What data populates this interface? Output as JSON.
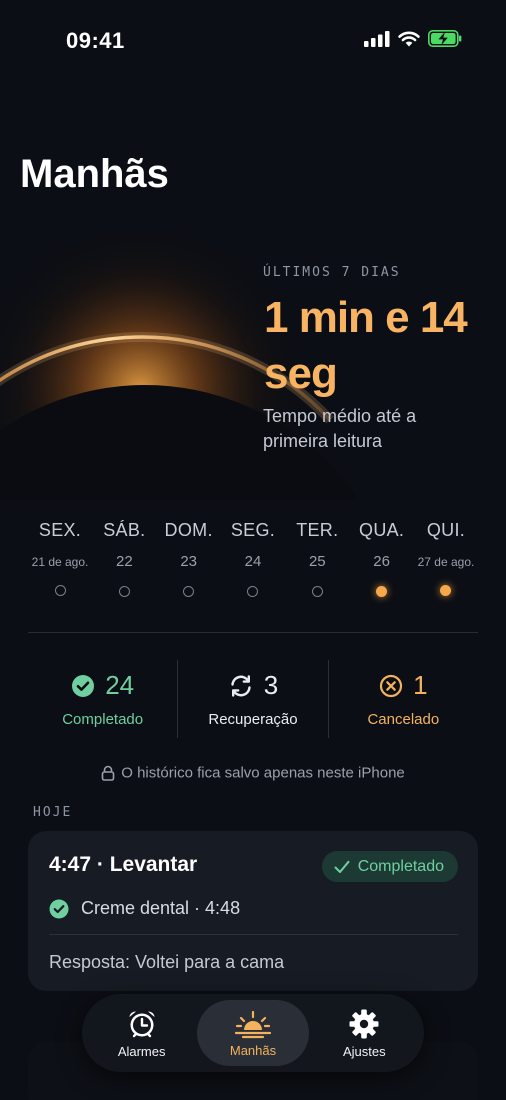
{
  "status_bar": {
    "time": "09:41"
  },
  "page": {
    "title": "Manhãs"
  },
  "hero": {
    "label": "ÚLTIMOS 7 DIAS",
    "value": "1 min e 14 seg",
    "subtitle": "Tempo médio até a primeira leitura"
  },
  "days": [
    {
      "name": "SEX.",
      "date": "21 de ago.",
      "filled": false
    },
    {
      "name": "SÁB.",
      "date": "22",
      "filled": false
    },
    {
      "name": "DOM.",
      "date": "23",
      "filled": false
    },
    {
      "name": "SEG.",
      "date": "24",
      "filled": false
    },
    {
      "name": "TER.",
      "date": "25",
      "filled": false
    },
    {
      "name": "QUA.",
      "date": "26",
      "filled": true
    },
    {
      "name": "QUI.",
      "date": "27 de ago.",
      "filled": true
    }
  ],
  "stats": {
    "completed": {
      "count": "24",
      "label": "Completado",
      "color": "#6fcf9f"
    },
    "recovery": {
      "count": "3",
      "label": "Recuperação",
      "color": "#e9ecf1"
    },
    "cancelled": {
      "count": "1",
      "label": "Cancelado",
      "color": "#f4b25e"
    }
  },
  "privacy_note": "O histórico fica salvo apenas neste iPhone",
  "today": {
    "section_label": "HOJE",
    "card": {
      "title": "4:47 · Levantar",
      "badge": "Completado",
      "task": "Creme dental · 4:48",
      "answer": "Resposta: Voltei para a cama"
    }
  },
  "tabs": [
    {
      "label": "Alarmes",
      "icon": "alarm-clock-icon",
      "active": false
    },
    {
      "label": "Manhãs",
      "icon": "sunrise-icon",
      "active": true
    },
    {
      "label": "Ajustes",
      "icon": "gear-icon",
      "active": false
    }
  ],
  "colors": {
    "accent": "#f4b25e",
    "success": "#6fcf9f",
    "background": "#0b0e14"
  }
}
